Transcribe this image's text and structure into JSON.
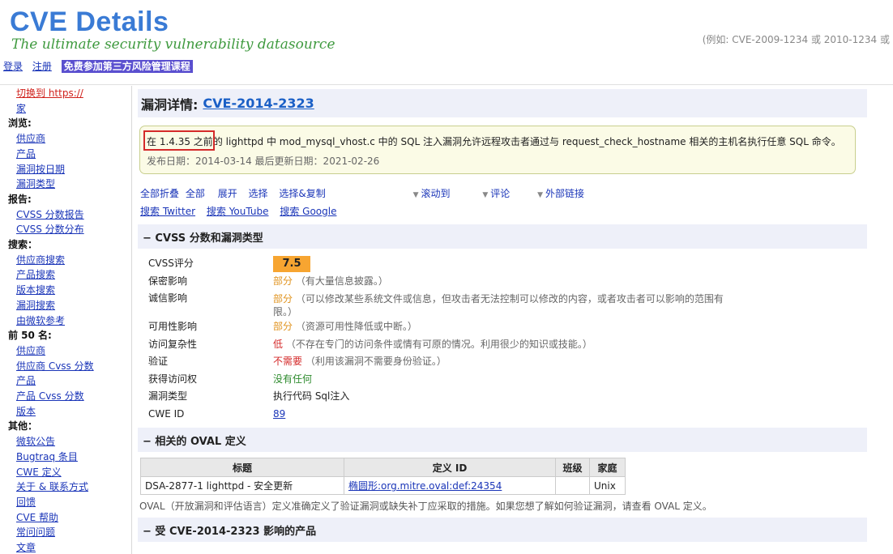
{
  "header": {
    "title": "CVE Details",
    "subtitle": "The ultimate security vulnerability datasource",
    "search_hint": "(例如: CVE-2009-1234 或 2010-1234 或",
    "links": [
      "登录",
      "注册"
    ],
    "promo": "免费参加第三方风险管理课程"
  },
  "sidebar": {
    "https_link": "切换到 https://",
    "home": "家",
    "sections": [
      {
        "title": "浏览:",
        "items": [
          "供应商",
          "产品",
          "漏洞按日期",
          "漏洞类型"
        ]
      },
      {
        "title": "报告:",
        "items": [
          "CVSS 分数报告",
          "CVSS 分数分布"
        ]
      },
      {
        "title": "搜索：",
        "items": [
          "供应商搜索",
          "产品搜索",
          "版本搜索",
          "漏洞搜索",
          "由微软参考"
        ]
      },
      {
        "title": "前 50 名:",
        "items": [
          "供应商",
          "供应商 Cvss 分数",
          "产品",
          "产品 Cvss 分数",
          "版本"
        ]
      },
      {
        "title": "其他：",
        "items": [
          "微软公告",
          "Bugtraq 条目",
          "CWE 定义",
          "关于 & 联系方式",
          "回馈",
          "CVE 帮助",
          "常问问题",
          "文章"
        ]
      }
    ]
  },
  "main": {
    "title_label": "漏洞详情:",
    "cve_id": "CVE-2014-2323",
    "summary_highlight": "在 1.4.35 之前",
    "summary_rest": "的 lighttpd 中 mod_mysql_vhost.c 中的 SQL 注入漏洞允许远程攻击者通过与 request_check_hostname 相关的主机名执行任意 SQL 命令。",
    "dates": "发布日期：2014-03-14 最后更新日期：2021-02-26",
    "actions": {
      "collapse_all": "全部折叠",
      "all": "全部",
      "expand": "展开",
      "select": "选择",
      "select_copy": "选择&复制",
      "scroll_to": "滚动到",
      "comments": "评论",
      "external_links": "外部链接",
      "search_twitter": "搜索 Twitter",
      "search_youtube": "搜索 YouTube",
      "search_google": "搜索 Google"
    },
    "cvss_section_title": "− CVSS 分数和漏洞类型",
    "cvss": {
      "score_label": "CVSS评分",
      "score": "7.5",
      "confidentiality_label": "保密影响",
      "confidentiality_value": "部分",
      "confidentiality_note": "（有大量信息披露。）",
      "integrity_label": "诚信影响",
      "integrity_value": "部分",
      "integrity_note": "（可以修改某些系统文件或信息，但攻击者无法控制可以修改的内容，或者攻击者可以影响的范围有限。）",
      "availability_label": "可用性影响",
      "availability_value": "部分",
      "availability_note": "（资源可用性降低或中断。）",
      "complexity_label": "访问复杂性",
      "complexity_value": "低",
      "complexity_note": "（不存在专门的访问条件或情有可原的情况。利用很少的知识或技能。）",
      "auth_label": "验证",
      "auth_value": "不需要",
      "auth_note": "（利用该漏洞不需要身份验证。）",
      "access_label": "获得访问权",
      "access_value": "没有任何",
      "vuln_type_label": "漏洞类型",
      "vuln_type_value": "执行代码 Sql注入",
      "cwe_label": "CWE ID",
      "cwe_value": "89"
    },
    "oval_section_title": "− 相关的 OVAL 定义",
    "oval_table": {
      "headers": [
        "标题",
        "定义 ID",
        "班级",
        "家庭"
      ],
      "row": [
        "DSA-2877-1 lighttpd - 安全更新",
        "椭圆形:org.mitre.oval:def:24354",
        "",
        "Unix"
      ]
    },
    "oval_note": "OVAL（开放漏洞和评估语言）定义准确定义了验证漏洞或缺失补丁应采取的措施。如果您想了解如何验证漏洞，请查看 OVAL 定义。",
    "products_section_title": "− 受 CVE-2014-2323 影响的产品"
  }
}
